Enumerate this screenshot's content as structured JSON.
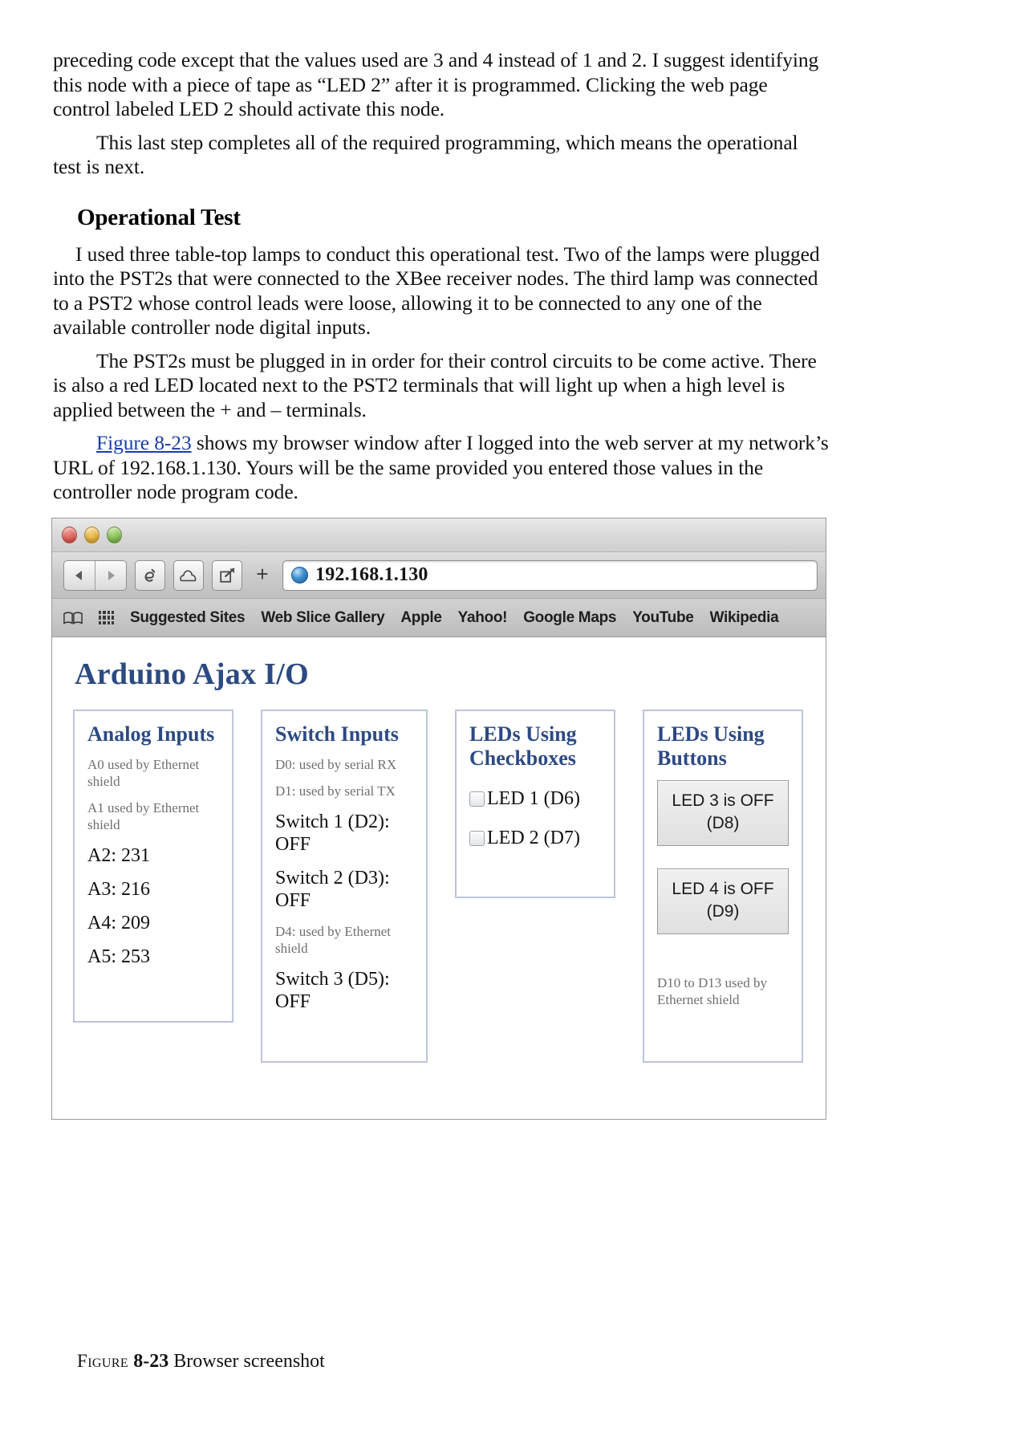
{
  "document": {
    "paragraphs": [
      "preceding code except that the values used are 3 and 4 instead of 1 and 2. I suggest identifying this node with a piece of tape as “LED 2” after it is programmed. Clicking the web page control labeled LED 2 should activate this node.",
      "This last step completes all of the required programming, which means the operational test is next."
    ],
    "section_heading": "Operational Test",
    "paragraphs2": [
      "I used three table-top lamps to conduct this operational test. Two of the lamps were plugged into the PST2s that were connected to the XBee receiver nodes. The third lamp was connected to a PST2 whose control leads were loose, allowing it to be connected to any one of the available controller node digital inputs.",
      "The PST2s must be plugged in in order for their control circuits to be come active. There is also a red LED located next to the PST2 terminals that will light up when a high level is applied between the + and – terminals."
    ],
    "figure_ref_paragraph": {
      "link": "Figure 8-23",
      "rest": " shows my browser window after I logged into the web server at my network’s URL of 192.168.1.130. Yours will be the same provided you entered those values in the controller node program code."
    },
    "caption": {
      "label": "Figure",
      "number": "8-23",
      "text": "Browser screenshot"
    }
  },
  "browser": {
    "window_controls": [
      "close",
      "minimize",
      "zoom"
    ],
    "toolbar": {
      "back_icon": "◀",
      "forward_icon": "▶",
      "reader_label": "é",
      "icloud_icon": "cloud",
      "share_icon": "share",
      "new_tab_label": "+",
      "url": "192.168.1.130"
    },
    "bookmarks": [
      "Suggested Sites",
      "Web Slice Gallery",
      "Apple",
      "Yahoo!",
      "Google Maps",
      "YouTube",
      "Wikipedia"
    ]
  },
  "webpage": {
    "title": "Arduino Ajax I/O",
    "panels": {
      "analog": {
        "title": "Analog Inputs",
        "rows": [
          {
            "text": "A0 used by Ethernet shield",
            "muted": true
          },
          {
            "text": "A1 used by Ethernet shield",
            "muted": true
          },
          {
            "text": "A2: 231",
            "muted": false
          },
          {
            "text": "A3: 216",
            "muted": false
          },
          {
            "text": "A4: 209",
            "muted": false
          },
          {
            "text": "A5: 253",
            "muted": false
          }
        ]
      },
      "switch": {
        "title": "Switch Inputs",
        "rows": [
          {
            "text": "D0: used by serial RX",
            "muted": true
          },
          {
            "text": "D1: used by serial TX",
            "muted": true
          },
          {
            "text": "Switch 1 (D2): OFF",
            "muted": false
          },
          {
            "text": "Switch 2 (D3): OFF",
            "muted": false
          },
          {
            "text": "D4: used by Ethernet shield",
            "muted": true
          },
          {
            "text": "Switch 3 (D5): OFF",
            "muted": false
          }
        ]
      },
      "checkboxes": {
        "title": "LEDs Using Checkboxes",
        "items": [
          {
            "label": "LED 1 (D6)",
            "checked": false
          },
          {
            "label": "LED 2 (D7)",
            "checked": false
          }
        ]
      },
      "buttons": {
        "title": "LEDs Using Buttons",
        "items": [
          {
            "line1": "LED 3 is OFF",
            "line2": "(D8)"
          },
          {
            "line1": "LED 4 is OFF",
            "line2": "(D9)"
          }
        ],
        "note": "D10 to D13 used by Ethernet shield"
      }
    }
  },
  "colors": {
    "heading_blue": "#2c4a82",
    "link_blue": "#1a3ea8",
    "panel_border": "#b9c6dc",
    "muted_text": "#6f6f6f"
  }
}
